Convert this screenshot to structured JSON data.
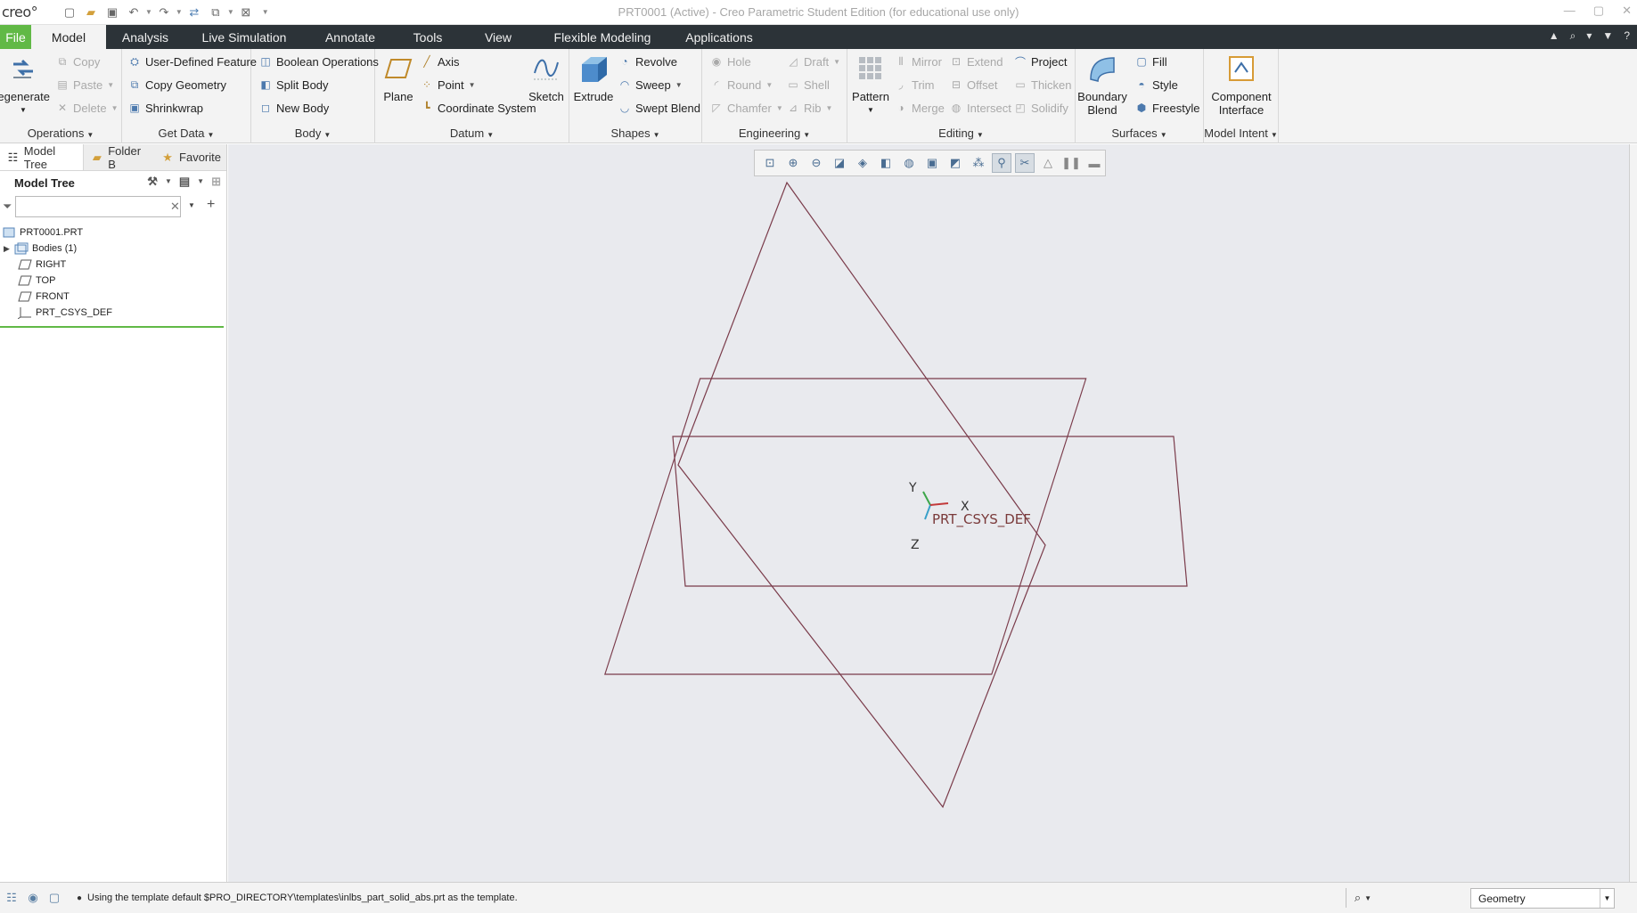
{
  "window": {
    "logo": "creo°",
    "title": "PRT0001 (Active) - Creo Parametric Student Edition (for educational use only)"
  },
  "menu": {
    "tabs": [
      "File",
      "Model",
      "Analysis",
      "Live Simulation",
      "Annotate",
      "Tools",
      "View",
      "Flexible Modeling",
      "Applications"
    ],
    "active": "Model"
  },
  "ribbon": {
    "operations": {
      "label": "Operations",
      "regenerate": "Regenerate",
      "copy": "Copy",
      "paste": "Paste",
      "delete": "Delete"
    },
    "get_data": {
      "label": "Get Data",
      "user_defined_feature": "User-Defined Feature",
      "copy_geometry": "Copy Geometry",
      "shrinkwrap": "Shrinkwrap"
    },
    "body": {
      "label": "Body",
      "boolean_operations": "Boolean Operations",
      "split_body": "Split Body",
      "new_body": "New Body"
    },
    "datum": {
      "label": "Datum",
      "plane": "Plane",
      "axis": "Axis",
      "point": "Point",
      "coordinate_system": "Coordinate System",
      "sketch": "Sketch"
    },
    "shapes": {
      "label": "Shapes",
      "extrude": "Extrude",
      "revolve": "Revolve",
      "sweep": "Sweep",
      "swept_blend": "Swept Blend"
    },
    "engineering": {
      "label": "Engineering",
      "hole": "Hole",
      "round": "Round",
      "chamfer": "Chamfer",
      "draft": "Draft",
      "shell": "Shell",
      "rib": "Rib"
    },
    "editing": {
      "label": "Editing",
      "pattern": "Pattern",
      "mirror": "Mirror",
      "trim": "Trim",
      "merge": "Merge",
      "extend": "Extend",
      "offset": "Offset",
      "intersect": "Intersect",
      "project": "Project",
      "thicken": "Thicken",
      "solidify": "Solidify"
    },
    "surfaces": {
      "label": "Surfaces",
      "boundary_blend_1": "Boundary",
      "boundary_blend_2": "Blend",
      "fill": "Fill",
      "style": "Style",
      "freestyle": "Freestyle"
    },
    "model_intent": {
      "label": "Model Intent",
      "component_interface_1": "Component",
      "component_interface_2": "Interface"
    }
  },
  "left_panel": {
    "tabs": [
      "Model Tree",
      "Folder B",
      "Favorite"
    ],
    "header": "Model Tree",
    "filter_value": "",
    "tree": [
      {
        "label": "PRT0001.PRT",
        "icon": "part-icon"
      },
      {
        "label": "Bodies (1)",
        "icon": "bodies-icon"
      },
      {
        "label": "RIGHT",
        "icon": "datum-plane-icon"
      },
      {
        "label": "TOP",
        "icon": "datum-plane-icon"
      },
      {
        "label": "FRONT",
        "icon": "datum-plane-icon"
      },
      {
        "label": "PRT_CSYS_DEF",
        "icon": "csys-icon"
      }
    ]
  },
  "graphics": {
    "csys_label": "PRT_CSYS_DEF",
    "axis_x": "X",
    "axis_y": "Y",
    "axis_z": "Z",
    "plane_color": "#7a3b4a"
  },
  "status": {
    "message": "Using the template default $PRO_DIRECTORY\\templates\\inlbs_part_solid_abs.prt as the template.",
    "selection_filter": "Geometry"
  },
  "colors": {
    "file_tab": "#61b946",
    "menubar": "#2c3338",
    "viewport": "#e9eaee"
  }
}
